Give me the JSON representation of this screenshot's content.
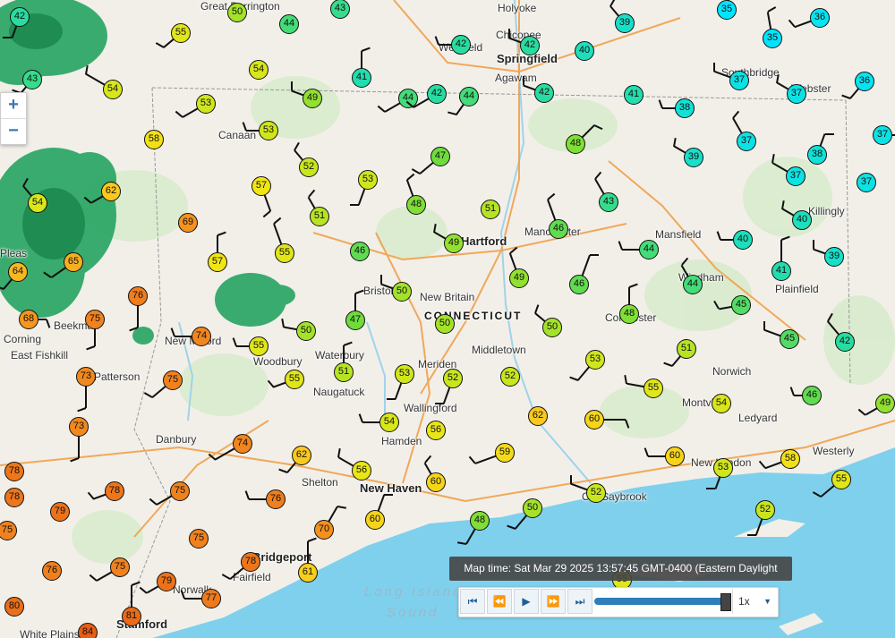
{
  "zoom": {
    "in_label": "+",
    "out_label": "−"
  },
  "time_label": "Map time: Sat Mar 29 2025 13:57:45 GMT-0400 (Eastern Daylight Time)",
  "player": {
    "first": "⏮",
    "prev": "⏪",
    "play": "▶",
    "next": "⏩",
    "last": "⏭",
    "speed": "1x",
    "speed_arrow": "▼",
    "progress": 1.0
  },
  "colors": {
    "water": "#7fd0ec",
    "land": "#f2efe9",
    "radar": "#1aa05a",
    "barb": "#111111"
  },
  "places": [
    {
      "name": "Holyoke",
      "cls": "town"
    },
    {
      "name": "Great Barrington",
      "cls": "town"
    },
    {
      "name": "Chicopee",
      "cls": "town"
    },
    {
      "name": "Springfield",
      "cls": "city"
    },
    {
      "name": "Westfield",
      "cls": "town"
    },
    {
      "name": "Agawam",
      "cls": "town"
    },
    {
      "name": "Southbridge",
      "cls": "town"
    },
    {
      "name": "Webster",
      "cls": "town"
    },
    {
      "name": "Canaan",
      "cls": "town"
    },
    {
      "name": "Hartford",
      "cls": "city"
    },
    {
      "name": "Manchester",
      "cls": "town"
    },
    {
      "name": "Mansfield",
      "cls": "town"
    },
    {
      "name": "Killingly",
      "cls": "town"
    },
    {
      "name": "Bristol",
      "cls": "town"
    },
    {
      "name": "New Britain",
      "cls": "town"
    },
    {
      "name": "CONNECTICUT",
      "cls": "state"
    },
    {
      "name": "Windham",
      "cls": "town"
    },
    {
      "name": "Plainfield",
      "cls": "town"
    },
    {
      "name": "New Milford",
      "cls": "town"
    },
    {
      "name": "Woodbury",
      "cls": "town"
    },
    {
      "name": "Waterbury",
      "cls": "town"
    },
    {
      "name": "Middletown",
      "cls": "town"
    },
    {
      "name": "Colchester",
      "cls": "town"
    },
    {
      "name": "Norwich",
      "cls": "town"
    },
    {
      "name": "Meriden",
      "cls": "town"
    },
    {
      "name": "Naugatuck",
      "cls": "town"
    },
    {
      "name": "Patterson",
      "cls": "town"
    },
    {
      "name": "Montville",
      "cls": "town"
    },
    {
      "name": "Ledyard",
      "cls": "town"
    },
    {
      "name": "East Fishkill",
      "cls": "town"
    },
    {
      "name": "Wallingford",
      "cls": "town"
    },
    {
      "name": "Danbury",
      "cls": "town"
    },
    {
      "name": "Hamden",
      "cls": "town"
    },
    {
      "name": "Westerly",
      "cls": "town"
    },
    {
      "name": "New London",
      "cls": "town"
    },
    {
      "name": "Shelton",
      "cls": "town"
    },
    {
      "name": "New Haven",
      "cls": "city"
    },
    {
      "name": "Old Saybrook",
      "cls": "town"
    },
    {
      "name": "Bridgeport",
      "cls": "city"
    },
    {
      "name": "Fairfield",
      "cls": "town"
    },
    {
      "name": "Norwalk",
      "cls": "town"
    },
    {
      "name": "Stamford",
      "cls": "city"
    },
    {
      "name": "White Plains",
      "cls": "town"
    },
    {
      "name": "Long Island",
      "cls": "water"
    },
    {
      "name": "Sound",
      "cls": "water"
    },
    {
      "name": "Corning",
      "cls": "town"
    },
    {
      "name": "Beekman",
      "cls": "town"
    },
    {
      "name": "Pleas",
      "cls": "town"
    }
  ],
  "stations": [
    {
      "t": 42
    },
    {
      "t": 50
    },
    {
      "t": 44
    },
    {
      "t": 43
    },
    {
      "t": 55
    },
    {
      "t": 42
    },
    {
      "t": 42
    },
    {
      "t": 40
    },
    {
      "t": 39
    },
    {
      "t": 35
    },
    {
      "t": 36
    },
    {
      "t": 35
    },
    {
      "t": 43
    },
    {
      "t": 54
    },
    {
      "t": 54
    },
    {
      "t": 53
    },
    {
      "t": 49
    },
    {
      "t": 41
    },
    {
      "t": 44
    },
    {
      "t": 42
    },
    {
      "t": 44
    },
    {
      "t": 42
    },
    {
      "t": 41
    },
    {
      "t": 38
    },
    {
      "t": 37
    },
    {
      "t": 37
    },
    {
      "t": 36
    },
    {
      "t": 37
    },
    {
      "t": 58
    },
    {
      "t": 53
    },
    {
      "t": 52
    },
    {
      "t": 53
    },
    {
      "t": 47
    },
    {
      "t": 48
    },
    {
      "t": 39
    },
    {
      "t": 37
    },
    {
      "t": 38
    },
    {
      "t": 37
    },
    {
      "t": 54
    },
    {
      "t": 62
    },
    {
      "t": 57
    },
    {
      "t": 48
    },
    {
      "t": 51
    },
    {
      "t": 43
    },
    {
      "t": 40
    },
    {
      "t": 37
    },
    {
      "t": 69
    },
    {
      "t": 51
    },
    {
      "t": 49
    },
    {
      "t": 46
    },
    {
      "t": 44
    },
    {
      "t": 40
    },
    {
      "t": 39
    },
    {
      "t": 41
    },
    {
      "t": 65
    },
    {
      "t": 57
    },
    {
      "t": 55
    },
    {
      "t": 46
    },
    {
      "t": 50
    },
    {
      "t": 49
    },
    {
      "t": 46
    },
    {
      "t": 44
    },
    {
      "t": 45
    },
    {
      "t": 64
    },
    {
      "t": 76
    },
    {
      "t": 55
    },
    {
      "t": 47
    },
    {
      "t": 50
    },
    {
      "t": 48
    },
    {
      "t": 68
    },
    {
      "t": 75
    },
    {
      "t": 50
    },
    {
      "t": 50
    },
    {
      "t": 45
    },
    {
      "t": 42
    },
    {
      "t": 74
    },
    {
      "t": 55
    },
    {
      "t": 51
    },
    {
      "t": 53
    },
    {
      "t": 52
    },
    {
      "t": 52
    },
    {
      "t": 53
    },
    {
      "t": 51
    },
    {
      "t": 73
    },
    {
      "t": 75
    },
    {
      "t": 54
    },
    {
      "t": 55
    },
    {
      "t": 54
    },
    {
      "t": 46
    },
    {
      "t": 49
    },
    {
      "t": 73
    },
    {
      "t": 56
    },
    {
      "t": 62
    },
    {
      "t": 60
    },
    {
      "t": 74
    },
    {
      "t": 62
    },
    {
      "t": 56
    },
    {
      "t": 60
    },
    {
      "t": 59
    },
    {
      "t": 60
    },
    {
      "t": 58
    },
    {
      "t": 78
    },
    {
      "t": 78
    },
    {
      "t": 75
    },
    {
      "t": 53
    },
    {
      "t": 55
    },
    {
      "t": 76
    },
    {
      "t": 70
    },
    {
      "t": 60
    },
    {
      "t": 52
    },
    {
      "t": 50
    },
    {
      "t": 48
    },
    {
      "t": 52
    },
    {
      "t": 79
    },
    {
      "t": 75
    },
    {
      "t": 75
    },
    {
      "t": 78
    },
    {
      "t": 61
    },
    {
      "t": 76
    },
    {
      "t": 79
    },
    {
      "t": 77
    },
    {
      "t": 80
    },
    {
      "t": 81
    },
    {
      "t": 84
    },
    {
      "t": 55
    },
    {
      "t": 75
    },
    {
      "t": 78
    }
  ]
}
